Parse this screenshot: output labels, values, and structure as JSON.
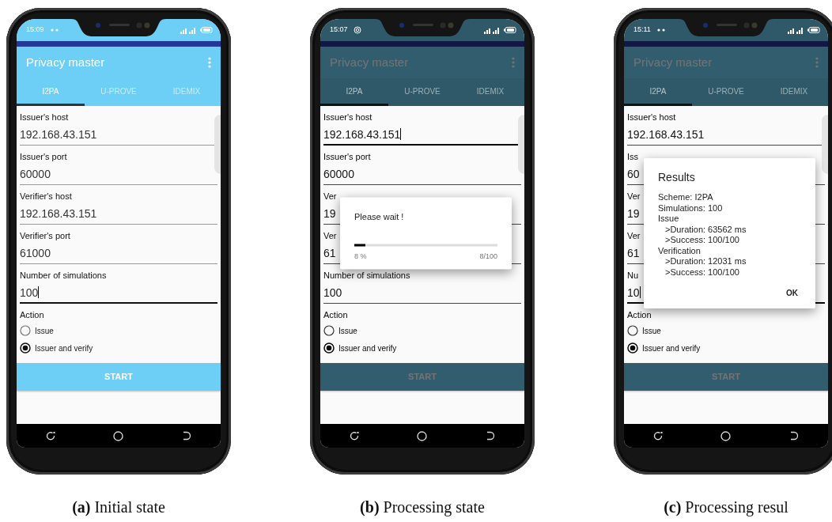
{
  "panels": [
    {
      "dimmed": false,
      "status_bar": {
        "time": "15:09",
        "notification_icon": {
          "kind": "dots"
        }
      },
      "app_bar": {
        "title": "Privacy master"
      },
      "tabs": [
        {
          "label": "I2PA",
          "selected": true
        },
        {
          "label": "U-PROVE",
          "selected": false
        },
        {
          "label": "IDEMIX",
          "selected": false
        }
      ],
      "fields": [
        {
          "label": "Issuer's host",
          "value": "192.168.43.151",
          "focused": false
        },
        {
          "label": "Issuer's port",
          "value": "60000",
          "focused": false
        },
        {
          "label": "Verifier's host",
          "value": "192.168.43.151",
          "focused": false
        },
        {
          "label": "Verifier's port",
          "value": "61000",
          "focused": false
        },
        {
          "label": "Number of simulations",
          "value": "100",
          "focused": true
        }
      ],
      "action": {
        "label": "Action",
        "options": [
          {
            "label": "Issue",
            "selected": false
          },
          {
            "label": "Issuer and verify",
            "selected": true
          }
        ]
      },
      "button": "START",
      "caption": "**(a)** Initial state"
    },
    {
      "dimmed": true,
      "status_bar": {
        "time": "15:07",
        "notification_icon": {
          "kind": "ring"
        }
      },
      "app_bar": {
        "title": "Privacy master"
      },
      "tabs": [
        {
          "label": "I2PA",
          "selected": true
        },
        {
          "label": "U-PROVE",
          "selected": false
        },
        {
          "label": "IDEMIX",
          "selected": false
        }
      ],
      "fields": [
        {
          "label": "Issuer's host",
          "value": "192.168.43.151",
          "focused": true
        },
        {
          "label": "Issuer's port",
          "value": "60000",
          "focused": false
        },
        {
          "label": "Ver",
          "value": "19",
          "focused": false
        },
        {
          "label": "Ver",
          "value": "61",
          "focused": false
        },
        {
          "label": "Number of simulations",
          "value": "100",
          "focused": false
        }
      ],
      "action": {
        "label": "Action",
        "options": [
          {
            "label": "Issue",
            "selected": false
          },
          {
            "label": "Issuer and verify",
            "selected": true
          }
        ]
      },
      "button": "START",
      "dialog": {
        "kind": "progress",
        "title": "Please wait !",
        "level": 0.08,
        "percent": "8 %",
        "count": "8/100"
      },
      "caption": "**(b)** Processing state"
    },
    {
      "dimmed": true,
      "status_bar": {
        "time": "15:11",
        "notification_icon": {
          "kind": "dots"
        }
      },
      "app_bar": {
        "title": "Privacy master"
      },
      "tabs": [
        {
          "label": "I2PA",
          "selected": true
        },
        {
          "label": "U-PROVE",
          "selected": false
        },
        {
          "label": "IDEMIX",
          "selected": false
        }
      ],
      "fields": [
        {
          "label": "Issuer's host",
          "value": "192.168.43.151",
          "focused": false
        },
        {
          "label": "Iss",
          "value": "60",
          "focused": false
        },
        {
          "label": "Ver",
          "value": "19",
          "focused": false
        },
        {
          "label": "Ver",
          "value": "61",
          "focused": false
        },
        {
          "label": "Nu",
          "value": "10",
          "focused": true
        }
      ],
      "action": {
        "label": "Action",
        "options": [
          {
            "label": "Issue",
            "selected": false
          },
          {
            "label": "Issuer and verify",
            "selected": true
          }
        ]
      },
      "button": "START",
      "dialog": {
        "kind": "results",
        "title": "Results",
        "lines": [
          {
            "text": "Scheme: I2PA"
          },
          {
            "text": "Simulations: 100"
          },
          {
            "text": "Issue",
            "children": [
              {
                "text": ">Duration: 63562 ms"
              },
              {
                "text": ">Success: 100/100"
              }
            ]
          },
          {
            "text": "Verification",
            "children": [
              {
                "text": ">Duration:  12031 ms"
              },
              {
                "text": ">Success: 100/100"
              }
            ]
          }
        ],
        "button": "OK"
      },
      "caption": "**(c)** Processing resul"
    }
  ]
}
